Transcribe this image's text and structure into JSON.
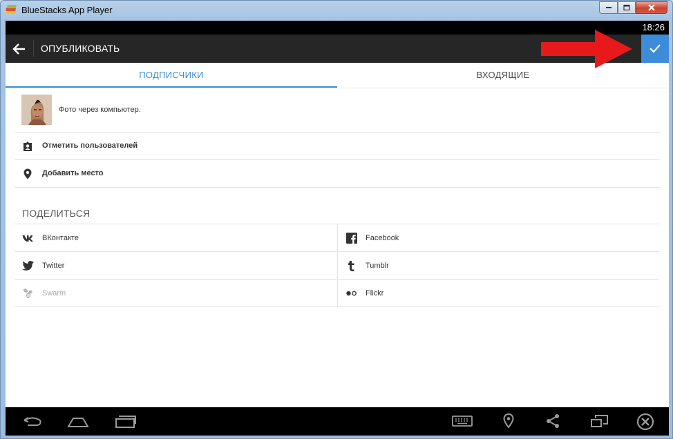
{
  "window": {
    "title": "BlueStacks App Player"
  },
  "statusbar": {
    "time": "18:26"
  },
  "actionbar": {
    "title": "ОПУБЛИКОВАТЬ"
  },
  "tabs": [
    {
      "label": "ПОДПИСЧИКИ",
      "active": true
    },
    {
      "label": "ВХОДЯЩИЕ",
      "active": false
    }
  ],
  "post": {
    "caption": "Фото через компьютер."
  },
  "options": [
    {
      "label": "Отметить пользователей",
      "icon": "tag-person-icon"
    },
    {
      "label": "Добавить место",
      "icon": "location-pin-icon"
    }
  ],
  "share": {
    "heading": "ПОДЕЛИТЬСЯ",
    "items": [
      {
        "label": "ВКонтакте",
        "icon": "vk-icon"
      },
      {
        "label": "Facebook",
        "icon": "facebook-icon"
      },
      {
        "label": "Twitter",
        "icon": "twitter-icon"
      },
      {
        "label": "Tumblr",
        "icon": "tumblr-icon"
      },
      {
        "label": "Swarm",
        "icon": "swarm-icon",
        "disabled": true
      },
      {
        "label": "Flickr",
        "icon": "flickr-icon"
      }
    ]
  },
  "colors": {
    "accent": "#3d8cd8",
    "actionbar": "#262626",
    "arrow": "#e8191b"
  }
}
